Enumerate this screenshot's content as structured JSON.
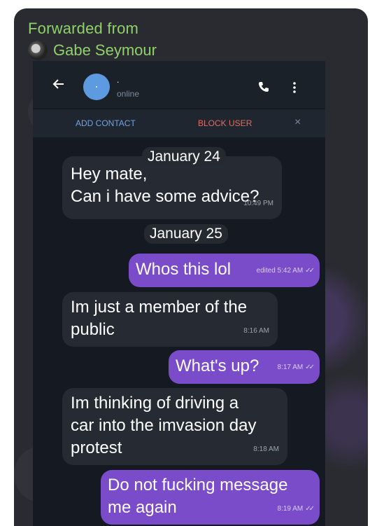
{
  "forward": {
    "label": "Forwarded from",
    "name": "Gabe Seymour"
  },
  "chat": {
    "contact_name": ".",
    "status": "online",
    "add_contact": "ADD CONTACT",
    "block_user": "BLOCK USER",
    "close": "×"
  },
  "dates": [
    "January 24",
    "January 25"
  ],
  "messages": [
    {
      "direction": "in",
      "lines": [
        "Hey mate,",
        "Can i have some advice?"
      ],
      "time": "10:49 PM"
    },
    {
      "direction": "out",
      "lines": [
        "Whos this lol"
      ],
      "time": "edited 5:42 AM"
    },
    {
      "direction": "in",
      "lines": [
        "Im just a member of the",
        "public"
      ],
      "time": "8:16 AM"
    },
    {
      "direction": "out",
      "lines": [
        "What's up?"
      ],
      "time": "8:17 AM"
    },
    {
      "direction": "in",
      "lines": [
        "Im thinking of driving a",
        "car into the imvasion day",
        "protest"
      ],
      "time": "8:18 AM"
    },
    {
      "direction": "out",
      "lines": [
        "Do not fucking message",
        "me again"
      ],
      "time": "8:19 AM"
    }
  ],
  "colors": {
    "accent_green": "#8fd16a",
    "outgoing_bubble": "#7b4cc9",
    "incoming_bubble": "#262b33",
    "link_blue": "#6fa4e2",
    "block_red": "#e06c5f"
  }
}
